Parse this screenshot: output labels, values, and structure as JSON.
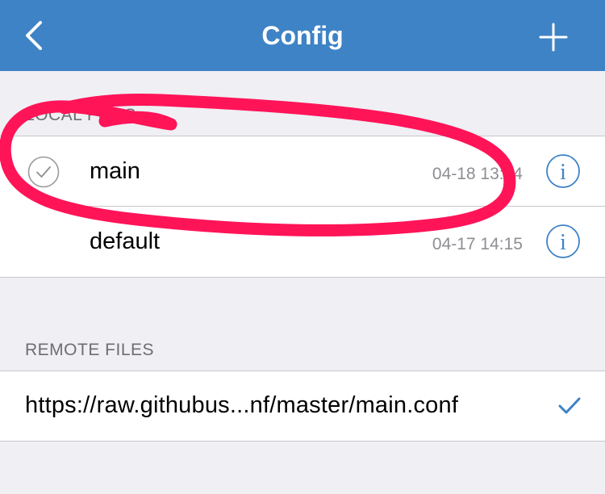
{
  "nav": {
    "title": "Config",
    "back_icon": "chevron-left-icon",
    "add_icon": "plus-icon",
    "bar_color": "#3e83c5"
  },
  "local_section": {
    "header": "LOCAL FILES",
    "items": [
      {
        "name": "main",
        "time": "04-18 13:44",
        "selected": true,
        "info_icon": "info-circle-icon"
      },
      {
        "name": "default",
        "time": "04-17 14:15",
        "selected": false,
        "info_icon": "info-circle-icon"
      }
    ]
  },
  "remote_section": {
    "header": "REMOTE FILES",
    "items": [
      {
        "url": "https://raw.githubus...nf/master/main.conf",
        "checked": true,
        "check_icon": "checkmark-icon"
      }
    ]
  },
  "annotation": {
    "color": "#ff1458",
    "shape": "hand-drawn-ellipse"
  }
}
